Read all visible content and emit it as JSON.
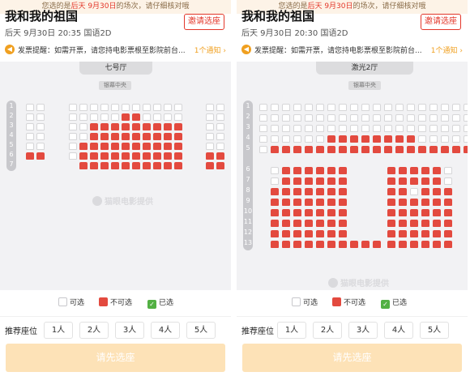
{
  "colors": {
    "taken": "#e34a3f",
    "available": "#ffffff",
    "selected": "#52b043",
    "accent": "#e3372a",
    "confirm_bg": "#fde2b7"
  },
  "panels": [
    {
      "notice_before": "您选的是",
      "notice_highlight": "后天 9月30日",
      "notice_after": "的场次，请仔细核对哦",
      "movie_title": "我和我的祖国",
      "invite_label": "邀请选座",
      "show_info": "后天 9月30日 20:35 国语2D",
      "invoice_icon": "speaker-icon",
      "invoice_text": "发票提醒：如需开票，请您持电影票根至影院前台...",
      "notice_count": "1个通知",
      "hall_name": "七号厅",
      "screen_label": "银幕中央",
      "row_labels": [
        "1",
        "2",
        "3",
        "4",
        "5",
        "6",
        "7"
      ],
      "watermark": "猫眼电影提供",
      "legend": {
        "available": "可选",
        "taken": "不可选",
        "selected": "已选"
      },
      "recommend_label": "推荐座位",
      "recommend_options": [
        "1人",
        "2人",
        "3人",
        "4人",
        "5人"
      ],
      "confirm_label": "请先选座"
    },
    {
      "notice_before": "您选的是",
      "notice_highlight": "后天 9月30日",
      "notice_after": "的场次，请仔细核对哦",
      "movie_title": "我和我的祖国",
      "invite_label": "邀请选座",
      "show_info": "后天 9月30日 20:30 国语2D",
      "invoice_icon": "speaker-icon",
      "invoice_text": "发票提醒：如需开票，请您持电影票根至影院前台...",
      "notice_count": "1个通知",
      "hall_name": "激光2厅",
      "screen_label": "银幕中央",
      "row_labels": [
        "1",
        "2",
        "3",
        "4",
        "5",
        "6",
        "7",
        "8",
        "9",
        "10",
        "11",
        "12",
        "13"
      ],
      "watermark": "猫眼电影提供",
      "legend": {
        "available": "可选",
        "taken": "不可选",
        "selected": "已选"
      },
      "recommend_label": "推荐座位",
      "recommend_options": [
        "1人",
        "2人",
        "3人",
        "4人",
        "5人"
      ],
      "confirm_label": "请先选座"
    }
  ]
}
